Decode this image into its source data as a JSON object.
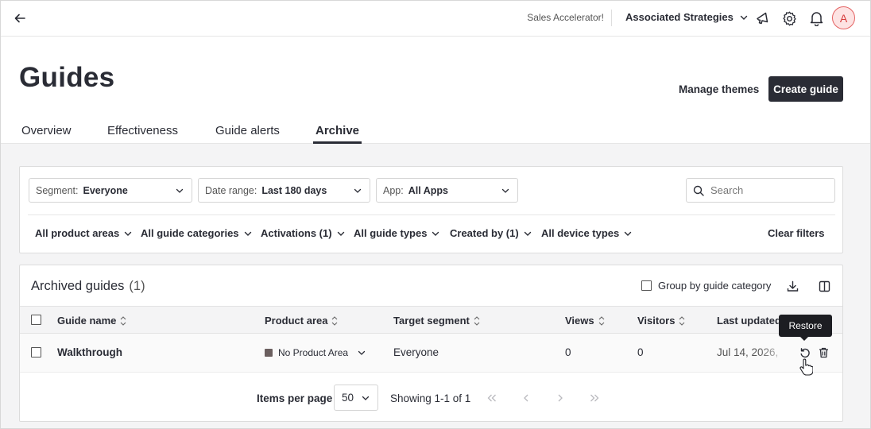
{
  "topbar": {
    "trial_text": "Sales Accelerator!",
    "account_name": "Associated Strategies",
    "avatar_initial": "A"
  },
  "header": {
    "title": "Guides",
    "manage_themes_label": "Manage themes",
    "create_guide_label": "Create guide"
  },
  "tabs": [
    {
      "label": "Overview",
      "active": false
    },
    {
      "label": "Effectiveness",
      "active": false
    },
    {
      "label": "Guide alerts",
      "active": false
    },
    {
      "label": "Archive",
      "active": true
    }
  ],
  "filters": {
    "segment": {
      "label": "Segment:",
      "value": "Everyone"
    },
    "date_range": {
      "label": "Date range:",
      "value": "Last 180 days"
    },
    "app": {
      "label": "App:",
      "value": "All Apps"
    },
    "search_placeholder": "Search",
    "chips": [
      "All product areas",
      "All guide categories",
      "Activations (1)",
      "All guide types",
      "Created by (1)",
      "All device types"
    ],
    "clear_label": "Clear filters"
  },
  "table": {
    "title": "Archived guides",
    "count": "(1)",
    "group_toggle_label": "Group by guide category",
    "columns": [
      "Guide name",
      "Product area",
      "Target segment",
      "Views",
      "Visitors",
      "Last updated"
    ],
    "rows": [
      {
        "guide_name": "Walkthrough",
        "product_area": "No Product Area",
        "target_segment": "Everyone",
        "views": "0",
        "visitors": "0",
        "last_updated": "Jul 14, 2026,"
      }
    ],
    "tooltip": "Restore"
  },
  "pagination": {
    "items_per_page_label": "Items per page",
    "per_page_value": "50",
    "showing_text": "Showing 1-1 of 1"
  },
  "colors": {
    "primary_button": "#2a2c35",
    "avatar_bg": "#fde3e3",
    "avatar_fg": "#d63b3b",
    "page_bg": "#f4f4f5"
  }
}
